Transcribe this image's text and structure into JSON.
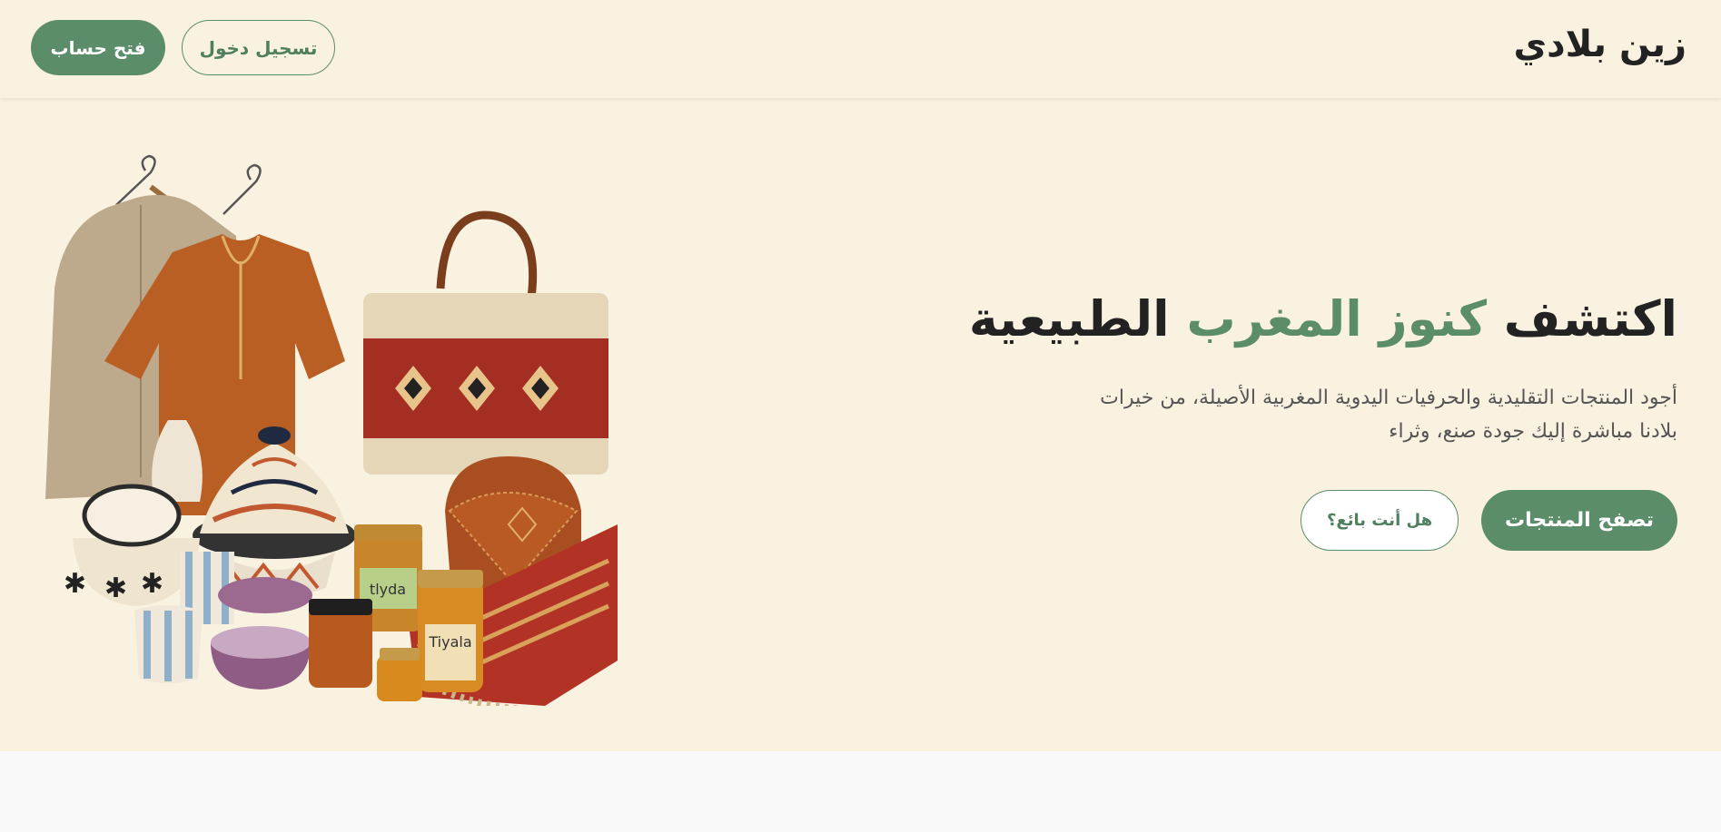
{
  "header": {
    "logo": "زين بلادي",
    "signup_label": "فتح حساب",
    "login_label": "تسجيل دخول"
  },
  "hero": {
    "title_start": "اكتشف ",
    "title_accent": "كنوز المغرب",
    "title_end": " الطبيعية",
    "description": "أجود المنتجات التقليدية والحرفيات اليدوية المغربية الأصيلة، من خيرات بلادنا مباشرة إليك جودة صنع، وثراء",
    "browse_label": "تصفح المنتجات",
    "seller_label": "هل أنت بائع؟",
    "image": {
      "jar_label_1": "tlyda",
      "jar_label_2": "Tiyala"
    }
  },
  "colors": {
    "cream": "#faf2e0",
    "green": "#5b8d6a",
    "text": "#222222"
  }
}
